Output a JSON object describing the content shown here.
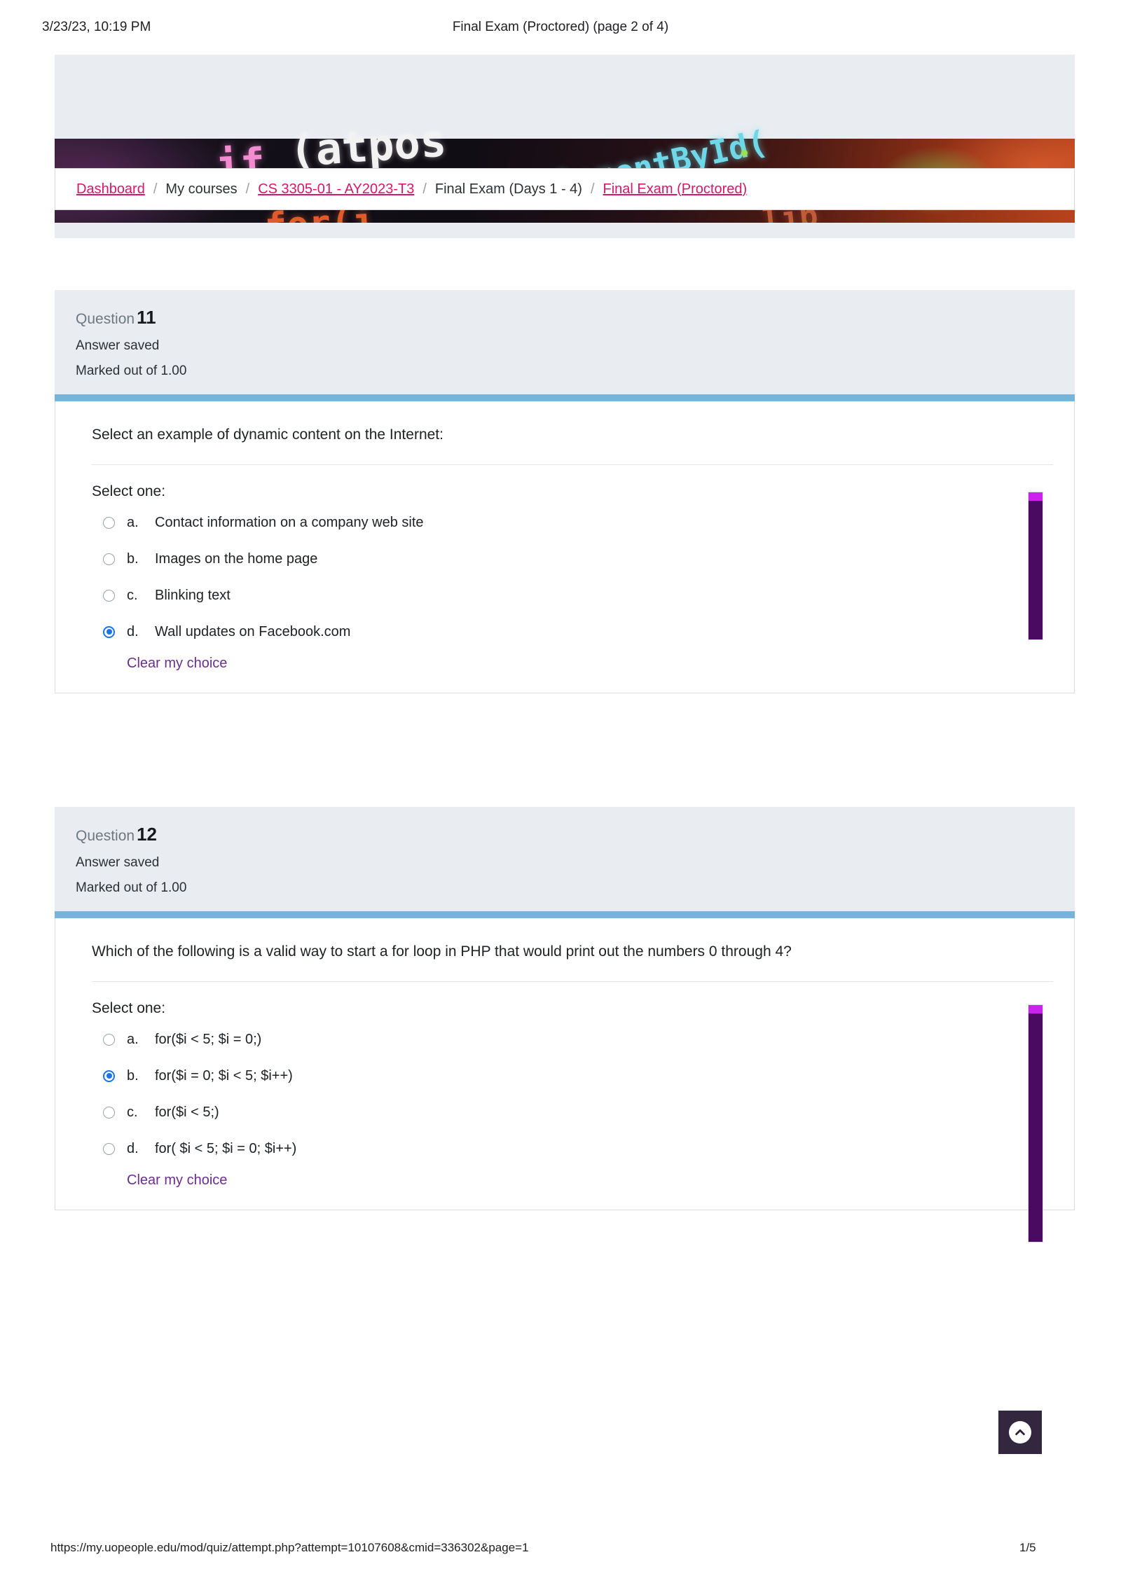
{
  "print_header": {
    "date": "3/23/23, 10:19 PM",
    "title": "Final Exam (Proctored) (page 2 of 4)"
  },
  "banner": {
    "code_fragments": {
      "if": "if",
      "atpos": "(atpos",
      "get_element": "tElementById(",
      "for": "for(i",
      "tail": "lib"
    }
  },
  "breadcrumb": {
    "items": [
      {
        "label": "Dashboard",
        "link": true
      },
      {
        "label": "My courses",
        "link": false
      },
      {
        "label": "CS 3305-01 - AY2023-T3",
        "link": true
      },
      {
        "label": "Final Exam (Days 1 - 4)",
        "link": false
      },
      {
        "label": "Final Exam (Proctored)",
        "link": true
      }
    ],
    "separator": "/"
  },
  "questions": [
    {
      "label": "Question",
      "number": "11",
      "state": "Answer saved",
      "marks": "Marked out of 1.00",
      "text": "Select an example of dynamic content on the Internet:",
      "select_one_label": "Select one:",
      "options": [
        {
          "letter": "a.",
          "text": "Contact information on a company web site",
          "selected": false
        },
        {
          "letter": "b.",
          "text": "Images on the home page",
          "selected": false
        },
        {
          "letter": "c.",
          "text": "Blinking text",
          "selected": false
        },
        {
          "letter": "d.",
          "text": "Wall updates on Facebook.com",
          "selected": true
        }
      ],
      "clear_label": "Clear my choice"
    },
    {
      "label": "Question",
      "number": "12",
      "state": "Answer saved",
      "marks": "Marked out of 1.00",
      "text": "Which of the following is a valid way to start a for loop in PHP that would print out the numbers 0 through 4?",
      "select_one_label": "Select one:",
      "options": [
        {
          "letter": "a.",
          "text": "for($i < 5; $i = 0;)",
          "selected": false
        },
        {
          "letter": "b.",
          "text": "for($i = 0; $i < 5; $i++)",
          "selected": true
        },
        {
          "letter": "c.",
          "text": "for($i < 5;)",
          "selected": false
        },
        {
          "letter": "d.",
          "text": "for( $i < 5; $i = 0; $i++)",
          "selected": false
        }
      ],
      "clear_label": "Clear my choice"
    }
  ],
  "scroll_top_button": {
    "icon": "chevron-up-icon"
  },
  "print_footer": {
    "url": "https://my.uopeople.edu/mod/quiz/attempt.php?attempt=10107608&cmid=336302&page=1",
    "page": "1/5"
  },
  "colors": {
    "accent_pink": "#d6176d",
    "divider_blue": "#76b4db",
    "header_gray": "#e9edf1",
    "link_purple": "#6b2e8f",
    "strip_purple": "#4a0a62",
    "strip_cap_magenta": "#cc22ee",
    "radio_blue": "#1a73e8",
    "to_top_bg": "#33263f"
  }
}
